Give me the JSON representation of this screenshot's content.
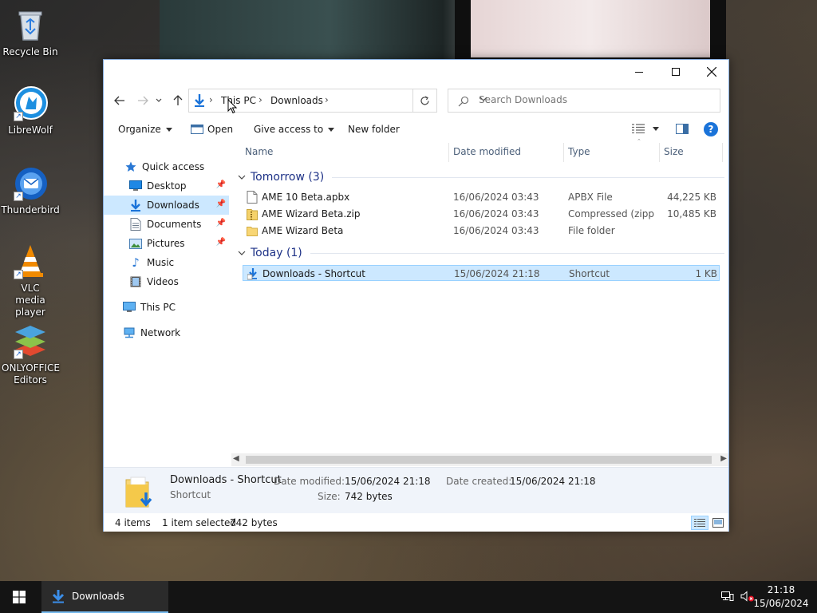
{
  "desktop": {
    "icons": [
      {
        "label": "Recycle Bin"
      },
      {
        "label": "LibreWolf"
      },
      {
        "label": "Thunderbird"
      },
      {
        "label": "VLC media player"
      },
      {
        "label": "ONLYOFFICE Editors"
      }
    ]
  },
  "window": {
    "controls": {
      "minimize": "minimize-icon",
      "maximize": "maximize-icon",
      "close": "close-icon"
    },
    "address": {
      "crumbs": [
        "This PC",
        "Downloads"
      ]
    },
    "search": {
      "placeholder": "Search Downloads"
    },
    "commands": {
      "organize": "Organize",
      "open": "Open",
      "give_access": "Give access to",
      "new_folder": "New folder"
    },
    "nav": {
      "quick_access": "Quick access",
      "desktop": "Desktop",
      "downloads": "Downloads",
      "documents": "Documents",
      "pictures": "Pictures",
      "music": "Music",
      "videos": "Videos",
      "this_pc": "This PC",
      "network": "Network"
    },
    "columns": {
      "name": "Name",
      "date": "Date modified",
      "type": "Type",
      "size": "Size"
    },
    "groups": [
      {
        "title": "Tomorrow (3)",
        "files": [
          {
            "name": "AME 10 Beta.apbx",
            "date": "16/06/2024 03:43",
            "type": "APBX File",
            "size": "44,225 KB"
          },
          {
            "name": "AME Wizard Beta.zip",
            "date": "16/06/2024 03:43",
            "type": "Compressed (zipp...",
            "size": "10,485 KB"
          },
          {
            "name": "AME Wizard Beta",
            "date": "16/06/2024 03:43",
            "type": "File folder",
            "size": ""
          }
        ]
      },
      {
        "title": "Today (1)",
        "files": [
          {
            "name": "Downloads - Shortcut",
            "date": "15/06/2024 21:18",
            "type": "Shortcut",
            "size": "1 KB"
          }
        ]
      }
    ],
    "details": {
      "name": "Downloads - Shortcut",
      "type": "Shortcut",
      "date_modified_label": "Date modified:",
      "date_modified": "15/06/2024 21:18",
      "size_label": "Size:",
      "size": "742 bytes",
      "date_created_label": "Date created:",
      "date_created": "15/06/2024 21:18"
    },
    "status": {
      "items": "4 items",
      "selected": "1 item selected",
      "selected_size": "742 bytes"
    }
  },
  "taskbar": {
    "app_label": "Downloads",
    "time": "21:18",
    "date": "15/06/2024"
  },
  "colors": {
    "accent": "#1a73d9",
    "selection": "#cce8ff",
    "group_header": "#1e3287"
  }
}
